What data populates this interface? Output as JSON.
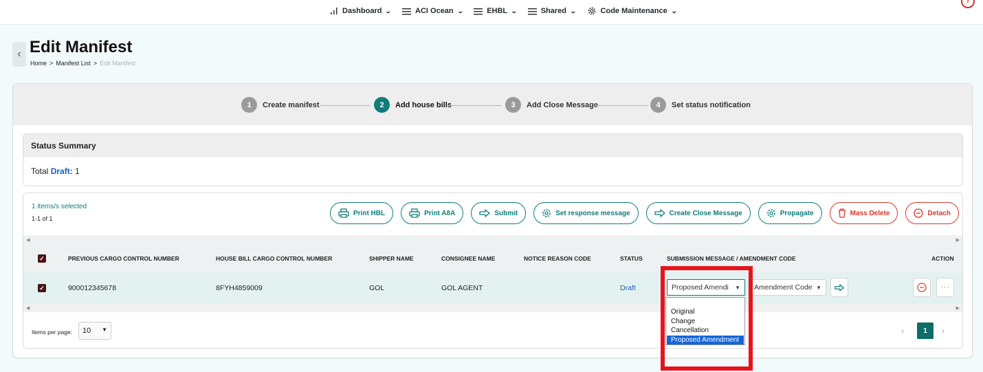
{
  "nav": {
    "items": [
      {
        "label": "Dashboard",
        "icon": "bar-chart-icon"
      },
      {
        "label": "ACI Ocean",
        "icon": "menu-icon"
      },
      {
        "label": "EHBL",
        "icon": "menu-icon"
      },
      {
        "label": "Shared",
        "icon": "menu-icon"
      },
      {
        "label": "Code Maintenance",
        "icon": "gear-icon"
      }
    ]
  },
  "page": {
    "title": "Edit Manifest",
    "breadcrumb": {
      "home": "Home",
      "sep": ">",
      "list": "Manifest List",
      "current": "Edit Manifest"
    }
  },
  "stepper": {
    "steps": [
      {
        "num": "1",
        "label": "Create manifest",
        "active": false
      },
      {
        "num": "2",
        "label": "Add house bills",
        "active": true
      },
      {
        "num": "3",
        "label": "Add Close Message",
        "active": false
      },
      {
        "num": "4",
        "label": "Set status notification",
        "active": false
      }
    ]
  },
  "status_summary": {
    "heading": "Status Summary",
    "total_label": "Total",
    "draft_label": "Draft:",
    "draft_count": "1"
  },
  "table": {
    "selected_text": "1 items/s selected",
    "range_text": "1-1 of 1",
    "actions": [
      {
        "label": "Print HBL",
        "icon": "printer-icon",
        "color": "#0e7c7b"
      },
      {
        "label": "Print A8A",
        "icon": "printer-icon",
        "color": "#0e7c7b"
      },
      {
        "label": "Submit",
        "icon": "arrow-right-icon",
        "color": "#0e7c7b"
      },
      {
        "label": "Set response message",
        "icon": "gear-icon",
        "color": "#0e7c7b"
      },
      {
        "label": "Create Close Message",
        "icon": "arrow-right-icon",
        "color": "#0e7c7b"
      },
      {
        "label": "Propagate",
        "icon": "gear-icon",
        "color": "#0e7c7b"
      },
      {
        "label": "Mass Delete",
        "icon": "trash-icon",
        "color": "#d9362b"
      },
      {
        "label": "Detach",
        "icon": "minus-circle-icon",
        "color": "#d9362b"
      }
    ],
    "columns": [
      "PREVIOUS CARGO CONTROL NUMBER",
      "HOUSE BILL CARGO CONTROL NUMBER",
      "SHIPPER NAME",
      "CONSIGNEE NAME",
      "NOTICE REASON CODE",
      "STATUS",
      "SUBMISSION MESSAGE / AMENDMENT CODE",
      "ACTION"
    ],
    "row": {
      "checked": true,
      "prev_ccn": "900012345678",
      "hbl_ccn": "8FYH4859009",
      "shipper": "GOL",
      "consignee": "GOL AGENT",
      "notice_reason": "",
      "status": "Draft",
      "submission_value": "Proposed Amendi",
      "amendment_placeholder": "Amendment Code"
    },
    "pager": {
      "items_per_page_label": "Items per page:",
      "items_per_page": "10",
      "current_page": "1"
    }
  },
  "dropdown": {
    "options": [
      "Original",
      "Change",
      "Cancellation",
      "Proposed Amendment"
    ],
    "selected": "Proposed Amendment"
  },
  "colors": {
    "accent": "#0e7c7b",
    "danger": "#d9362b",
    "highlight": "#e8141c",
    "link": "#1a5fb4"
  }
}
